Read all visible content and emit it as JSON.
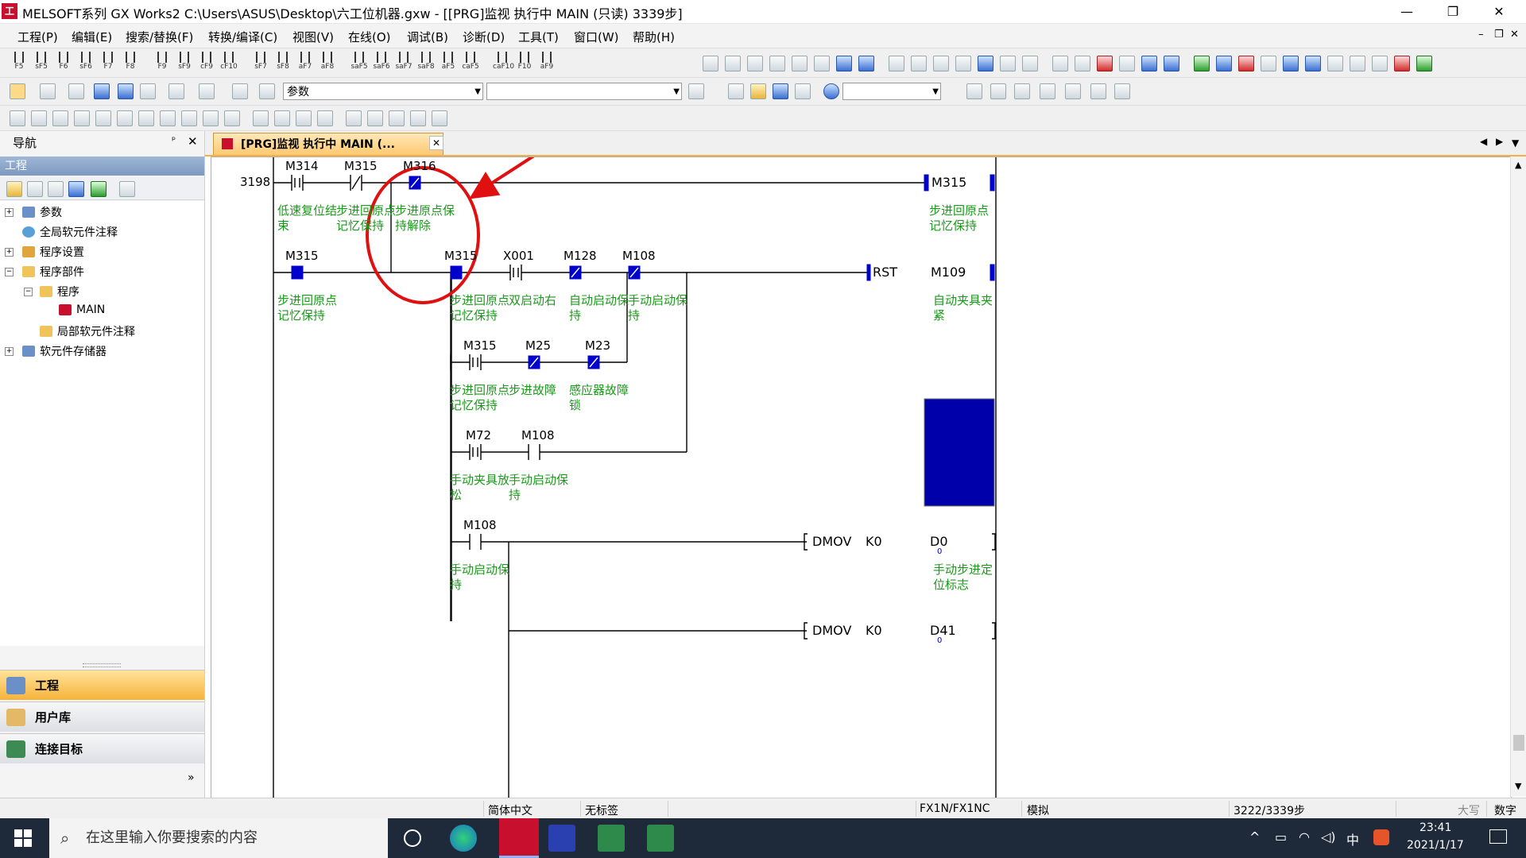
{
  "window": {
    "title": "MELSOFT系列 GX Works2 C:\\Users\\ASUS\\Desktop\\六工位机器.gxw - [[PRG]监视 执行中 MAIN (只读) 3339步]",
    "app_icon": "工",
    "minimize": "—",
    "restore": "❐",
    "close": "✕"
  },
  "menu": [
    "工程(P)",
    "编辑(E)",
    "搜索/替换(F)",
    "转换/编译(C)",
    "视图(V)",
    "在线(O)",
    "调试(B)",
    "诊断(D)",
    "工具(T)",
    "窗口(W)",
    "帮助(H)"
  ],
  "toolbar": {
    "f_keys": [
      "F5",
      "sF5",
      "F6",
      "sF6",
      "F7",
      "F8",
      "F9",
      "sF9",
      "cF9",
      "cF10",
      "sF7",
      "sF8",
      "aF7",
      "aF8",
      "saF5",
      "saF6",
      "saF7",
      "saF8",
      "aF5",
      "caF5",
      "caF10",
      "F10",
      "aF9"
    ],
    "param_combo": "参数",
    "combo2": "",
    "combo3": ""
  },
  "nav": {
    "header": "导航",
    "pin": "ᵖ",
    "close": "✕",
    "section": "工程",
    "tree": [
      {
        "label": "参数",
        "indent": 0,
        "expander": "+"
      },
      {
        "label": "全局软元件注释",
        "indent": 0,
        "expander": ""
      },
      {
        "label": "程序设置",
        "indent": 0,
        "expander": "+"
      },
      {
        "label": "程序部件",
        "indent": 0,
        "expander": "−"
      },
      {
        "label": "程序",
        "indent": 1,
        "expander": "−"
      },
      {
        "label": "MAIN",
        "indent": 2,
        "expander": ""
      },
      {
        "label": "局部软元件注释",
        "indent": 1,
        "expander": ""
      },
      {
        "label": "软元件存储器",
        "indent": 0,
        "expander": "+"
      }
    ],
    "bottom_buttons": [
      "工程",
      "用户库",
      "连接目标"
    ],
    "more": "»"
  },
  "tab": {
    "label": "[PRG]监视 执行中 MAIN (...",
    "close": "✕"
  },
  "ladder": {
    "step": "3198",
    "rung1": {
      "contacts": [
        {
          "dev": "M314",
          "cmt": "低速复位结束"
        },
        {
          "dev": "M315",
          "cmt": "步进回原点记忆保持"
        },
        {
          "dev": "M316",
          "cmt": "步进原点保持解除"
        }
      ],
      "coil": {
        "dev": "M315",
        "cmt": "步进回原点记忆保持"
      }
    },
    "seal": {
      "dev": "M315",
      "cmt": "步进回原点记忆保持"
    },
    "rung2": {
      "contacts": [
        {
          "dev": "M315",
          "cmt": "步进回原点记忆保持"
        },
        {
          "dev": "X001",
          "cmt": "双启动右"
        },
        {
          "dev": "M128",
          "cmt": "自动启动保持"
        },
        {
          "dev": "M108",
          "cmt": "手动启动保持"
        }
      ],
      "instr": "RST",
      "target": {
        "dev": "M109",
        "cmt": "自动夹具夹紧"
      }
    },
    "branch2": [
      {
        "dev": "M315",
        "cmt": "步进回原点记忆保持"
      },
      {
        "dev": "M25",
        "cmt": "步进故障"
      },
      {
        "dev": "M23",
        "cmt": "感应器故障锁"
      }
    ],
    "branch3": [
      {
        "dev": "M72",
        "cmt": "手动夹具放松"
      },
      {
        "dev": "M108",
        "cmt": "手动启动保持"
      }
    ],
    "rung3": {
      "contact": {
        "dev": "M108",
        "cmt": "手动启动保持"
      },
      "instr": "DMOV",
      "src": "K0",
      "dst": {
        "dev": "D0",
        "value": "0",
        "cmt": "手动步进定位标志"
      }
    },
    "rung4": {
      "instr": "DMOV",
      "src": "K0",
      "dst": {
        "dev": "D41",
        "value": "0"
      }
    }
  },
  "status": {
    "lang": "简体中文",
    "label": "无标签",
    "plc": "FX1N/FX1NC",
    "mode": "模拟",
    "steps": "3222/3339步",
    "caps": "大写",
    "num": "数字"
  },
  "taskbar": {
    "search_placeholder": "在这里输入你要搜索的内容",
    "tray_lang": "中",
    "time": "23:41",
    "date": "2021/1/17"
  },
  "colors": {
    "ladder_green": "#1a9a1a",
    "monitor_blue": "#0000cc",
    "annotation_red": "#e01010",
    "tab_orange": "#ffc870"
  }
}
